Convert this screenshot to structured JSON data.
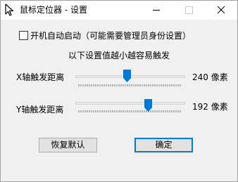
{
  "window": {
    "title": "鼠标定位器 - 设置"
  },
  "settings": {
    "autostart_label": "开机自动启动（可能需要管理员身份设置）",
    "autostart_checked": false,
    "hint": "以下设置值越小越容易触发"
  },
  "x_distance": {
    "label": "X轴触发距离",
    "value": 240,
    "value_text": "240 像素"
  },
  "y_distance": {
    "label": "Y轴触发距离",
    "value": 192,
    "value_text": "192 像素"
  },
  "buttons": {
    "reset": "恢复默认",
    "ok": "确定"
  },
  "icons": {
    "app": "cursor-arrow-icon",
    "minimize": "minimize-icon",
    "maximize": "maximize-icon",
    "close": "close-icon"
  },
  "colors": {
    "thumb": "#0078d7",
    "track": "#e7eaea",
    "track_border": "#d6d6d6"
  }
}
